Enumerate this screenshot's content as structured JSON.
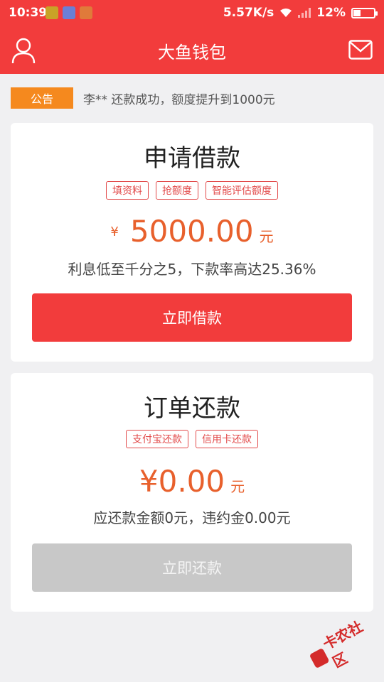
{
  "status_bar": {
    "time": "10:39",
    "speed": "5.57K/s",
    "battery": "12%"
  },
  "header": {
    "title": "大鱼钱包",
    "user_icon": "user-icon",
    "mail_icon": "mail-icon"
  },
  "notice": {
    "tag": "公告",
    "text": "李** 还款成功，额度提升到1000元"
  },
  "loan_card": {
    "title": "申请借款",
    "tags": [
      "填资料",
      "抢额度",
      "智能评估额度"
    ],
    "currency": "¥",
    "amount": "5000.00",
    "unit": "元",
    "desc": "利息低至千分之5，下款率高达25.36%",
    "button": "立即借款"
  },
  "repay_card": {
    "title": "订单还款",
    "tags": [
      "支付宝还款",
      "信用卡还款"
    ],
    "amount": "¥0.00",
    "unit": "元",
    "desc": "应还款金额0元，违约金0.00元",
    "button": "立即还款"
  },
  "watermark": {
    "text": "卡农社区"
  },
  "colors": {
    "primary_red": "#f23c3c",
    "amount_orange": "#e8602c",
    "notice_orange": "#f5891e",
    "disabled_gray": "#c8c8c8"
  }
}
